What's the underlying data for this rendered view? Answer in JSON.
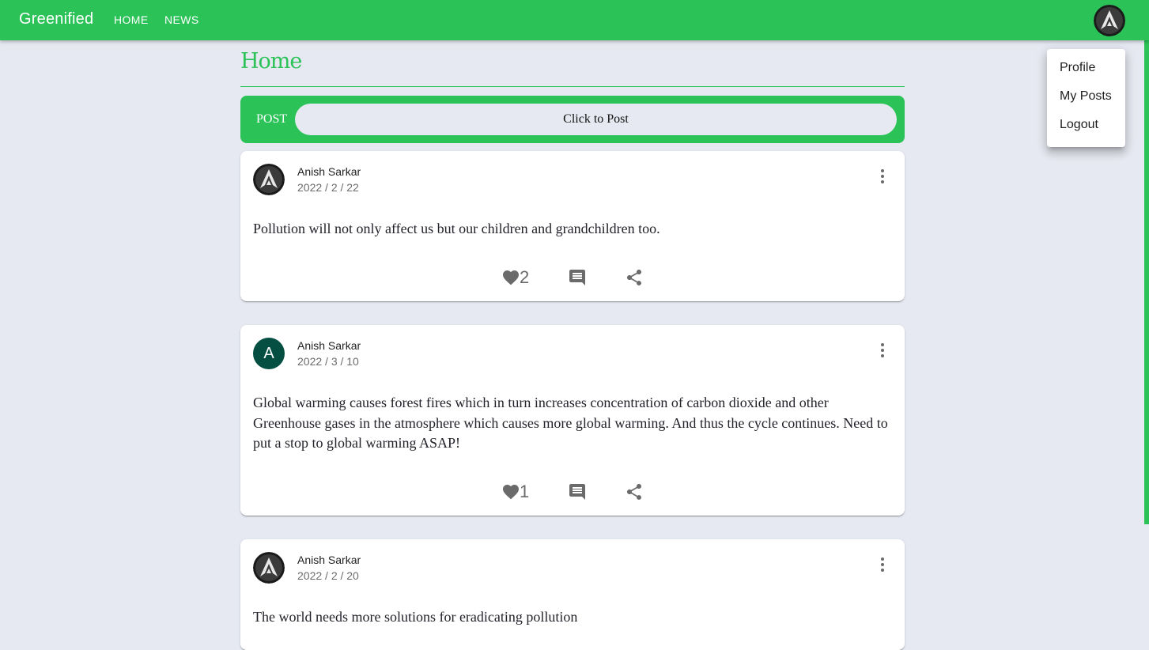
{
  "navbar": {
    "brand": "Greenified",
    "links": [
      "HOME",
      "NEWS"
    ],
    "avatar_icon": "assassin-logo-icon"
  },
  "account_menu": {
    "items": [
      "Profile",
      "My Posts",
      "Logout"
    ]
  },
  "page": {
    "title": "Home"
  },
  "post_composer": {
    "label": "POST",
    "prompt": "Click to Post"
  },
  "posts": [
    {
      "author": "Anish Sarkar",
      "date": "2022 / 2 / 22",
      "avatar": "assassin-logo-icon",
      "text": "Pollution will not only affect us but our children and grandchildren too.",
      "likes": "2"
    },
    {
      "author": "Anish Sarkar",
      "date": "2022 / 3 / 10",
      "avatar_letter": "A",
      "text": "Global warming causes forest fires which in turn increases concentration of carbon dioxide and other Greenhouse gases in the atmosphere which causes more global warming. And thus the cycle continues. Need to put a stop to global warming ASAP!",
      "likes": "1"
    },
    {
      "author": "Anish Sarkar",
      "date": "2022 / 2 / 20",
      "avatar": "assassin-logo-icon",
      "text": "The world needs more solutions for eradicating pollution"
    }
  ],
  "icons": {
    "like": "heart-icon",
    "comment": "comment-icon",
    "share": "share-icon",
    "more": "more-vert-icon"
  },
  "colors": {
    "brand_green": "#2bc257",
    "background": "#e6e9f1",
    "avatar_teal": "#044f42",
    "icon_grey": "#6a6a6a"
  }
}
